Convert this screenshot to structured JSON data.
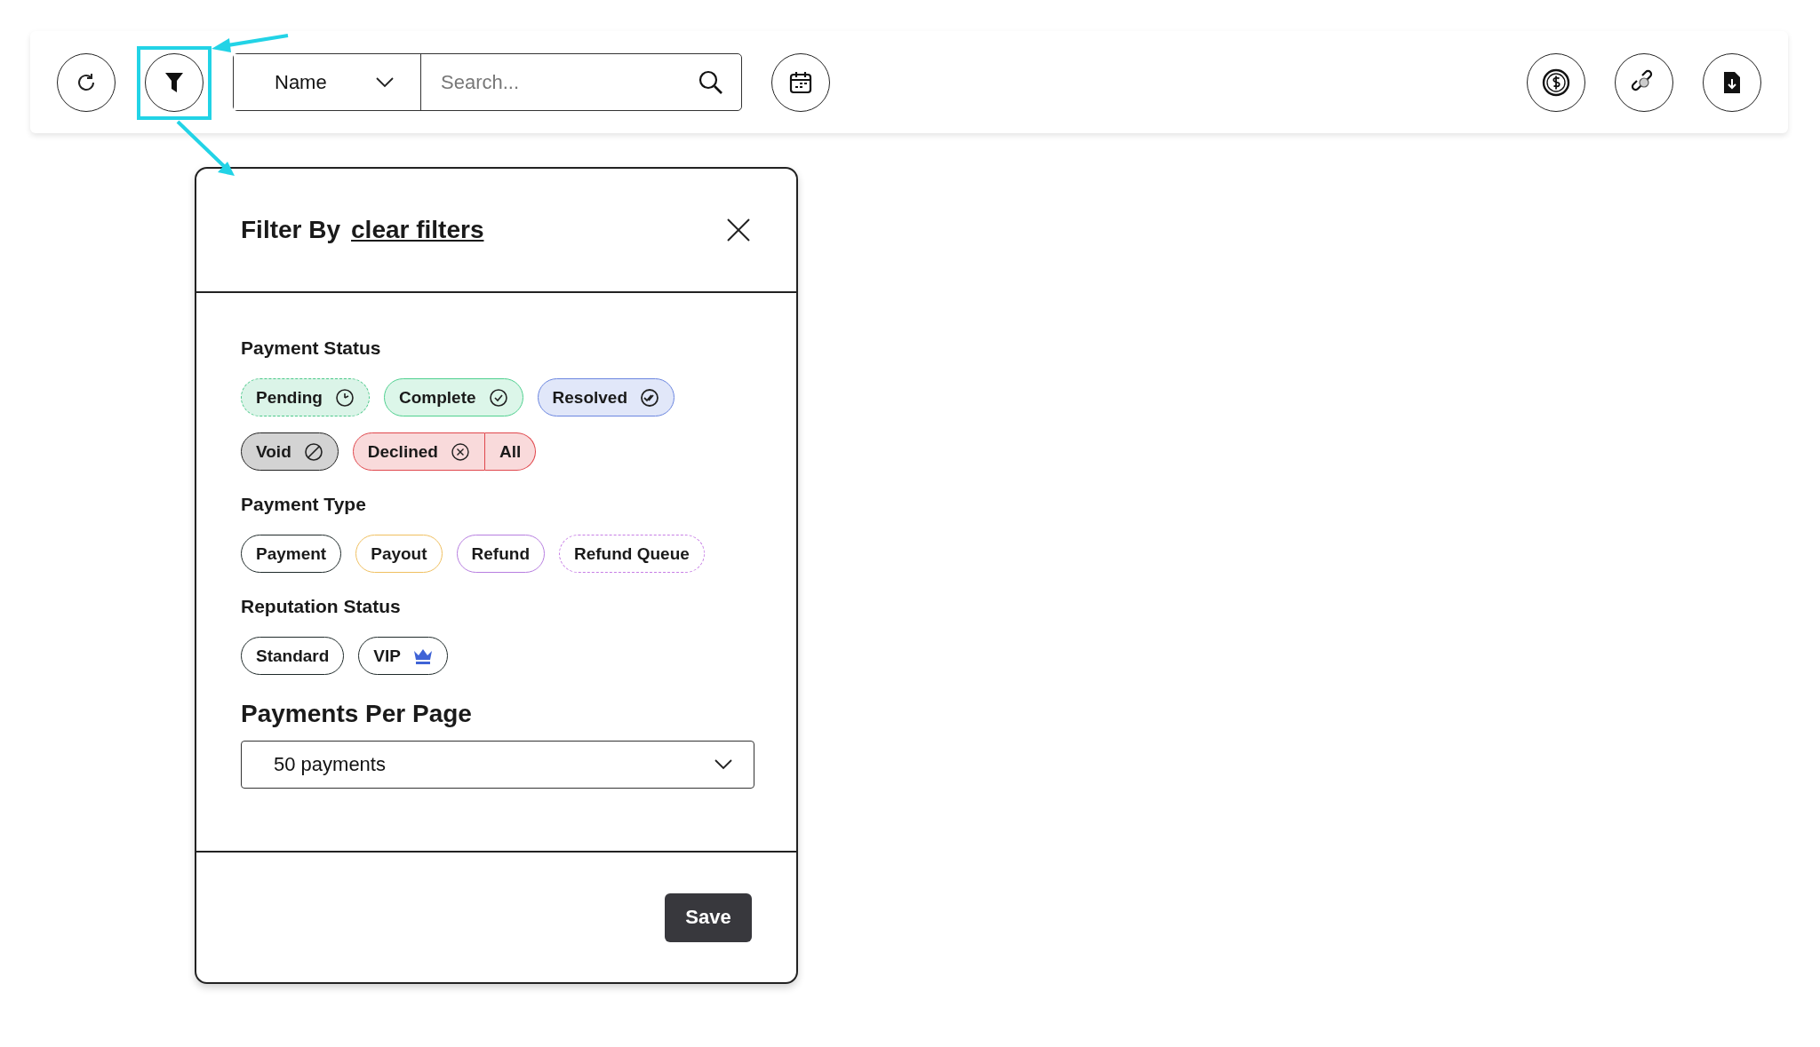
{
  "toolbar": {
    "search_by": "Name",
    "search": {
      "placeholder": "Search..."
    }
  },
  "filter_panel": {
    "title": "Filter By",
    "clear_link": "clear filters",
    "sections": [
      {
        "label": "Payment Status",
        "chips": [
          {
            "label": "Pending",
            "kind": "clock",
            "color": "#4cc98a",
            "filled": true,
            "dashed": true
          },
          {
            "label": "Complete",
            "kind": "check",
            "color": "#4fd08f",
            "filled": true,
            "dashed": false
          },
          {
            "label": "Resolved",
            "kind": "doublecheck",
            "color": "#6b86e0",
            "filled": true,
            "dashed": false
          },
          {
            "label": "Void",
            "kind": "ban",
            "color": "#222222",
            "filled": true,
            "dashed": false
          },
          {
            "label": "Declined",
            "kind": "cross",
            "color": "#e0474c",
            "filled": true,
            "dashed": false
          },
          {
            "label": "All",
            "kind": "joined",
            "color": "#e0474c",
            "filled": true,
            "dashed": false
          }
        ]
      },
      {
        "label": "Payment Type",
        "chips": [
          {
            "label": "Payment",
            "kind": "plain",
            "color": "#1f2a2a",
            "filled": false,
            "dashed": false
          },
          {
            "label": "Payout",
            "kind": "plain",
            "color": "#f0c060",
            "filled": false,
            "dashed": false
          },
          {
            "label": "Refund",
            "kind": "plain",
            "color": "#b77ee0",
            "filled": false,
            "dashed": false
          },
          {
            "label": "Refund Queue",
            "kind": "plain",
            "color": "#c77ee6",
            "filled": false,
            "dashed": true
          }
        ]
      },
      {
        "label": "Reputation Status",
        "chips": [
          {
            "label": "Standard",
            "kind": "plain",
            "color": "#1f2a2a",
            "filled": false,
            "dashed": false
          },
          {
            "label": "VIP",
            "kind": "crown",
            "color": "#1f2a2a",
            "filled": false,
            "dashed": false
          }
        ]
      }
    ],
    "per_page": {
      "label": "Payments Per Page",
      "value": "50 payments"
    },
    "save": "Save"
  }
}
